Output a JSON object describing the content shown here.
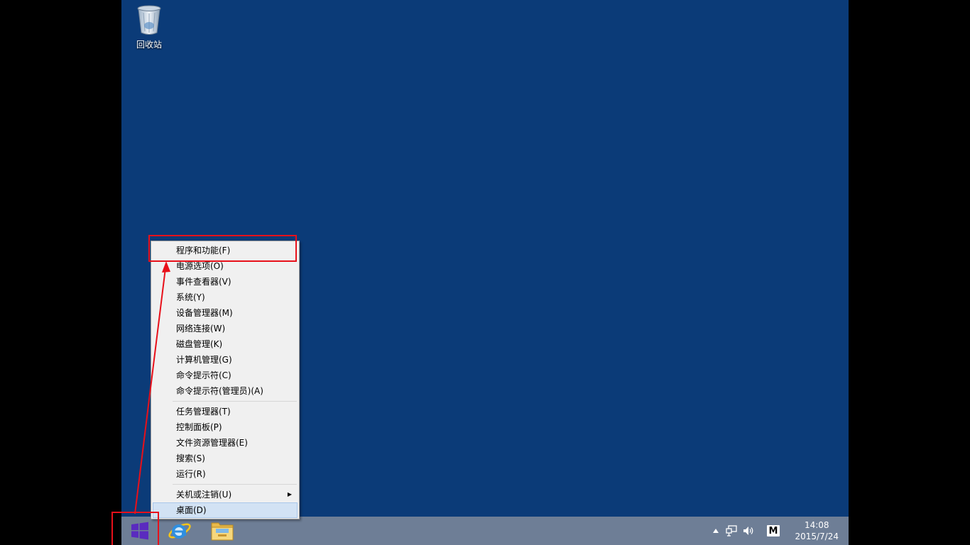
{
  "desktop": {
    "icons": [
      {
        "label": "回收站",
        "icon": "recycle-bin-icon"
      }
    ]
  },
  "context_menu": {
    "groups": [
      [
        "程序和功能(F)",
        "电源选项(O)",
        "事件查看器(V)",
        "系统(Y)",
        "设备管理器(M)",
        "网络连接(W)",
        "磁盘管理(K)",
        "计算机管理(G)",
        "命令提示符(C)",
        "命令提示符(管理员)(A)"
      ],
      [
        "任务管理器(T)",
        "控制面板(P)",
        "文件资源管理器(E)",
        "搜索(S)",
        "运行(R)"
      ],
      [
        "关机或注销(U)",
        "桌面(D)"
      ]
    ],
    "highlighted_item": "桌面(D)",
    "submenu_item": "关机或注销(U)"
  },
  "taskbar": {
    "pinned": [
      "start-icon",
      "internet-explorer-icon",
      "file-explorer-icon"
    ],
    "tray": {
      "ime_label": "M",
      "time": "14:08",
      "date": "2015/7/24"
    }
  },
  "colors": {
    "desktop_background": "#0b3b78",
    "taskbar": "#6e7e96",
    "annotation": "#e8101a",
    "menu_highlight": "#d2e2f4"
  }
}
